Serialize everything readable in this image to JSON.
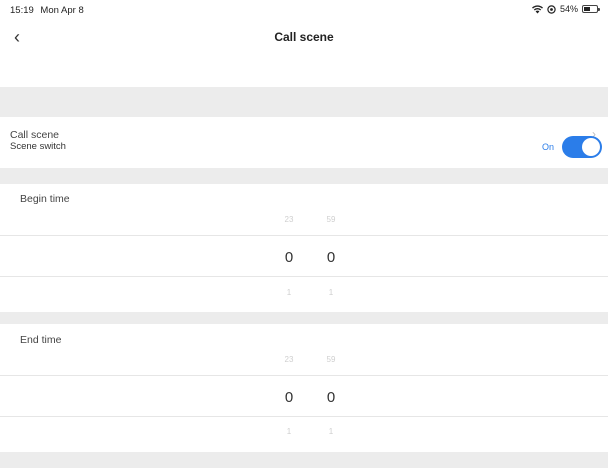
{
  "status": {
    "time": "15:19",
    "date": "Mon Apr 8",
    "battery": "54%",
    "battery_level": 0.54
  },
  "nav": {
    "back_icon": "‹",
    "title": "Call scene"
  },
  "rows": {
    "call_scene": {
      "label": "Call scene",
      "chevron": "›"
    },
    "scene_switch": {
      "label": "Scene switch",
      "state": "On",
      "on": true
    }
  },
  "begin": {
    "title": "Begin time",
    "hour": {
      "above": "23",
      "value": "0",
      "below": "1"
    },
    "minute": {
      "above": "59",
      "value": "0",
      "below": "1"
    }
  },
  "end": {
    "title": "End time",
    "hour": {
      "above": "23",
      "value": "0",
      "below": "1"
    },
    "minute": {
      "above": "59",
      "value": "0",
      "below": "1"
    }
  },
  "colors": {
    "accent": "#2b7de9",
    "separator": "#ececec"
  },
  "icons": [
    "back-icon",
    "wifi-icon",
    "location-icon",
    "battery-icon",
    "chevron-right-icon"
  ]
}
